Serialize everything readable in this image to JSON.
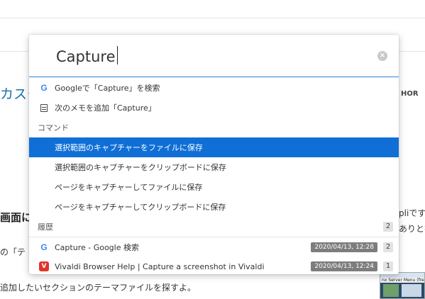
{
  "background": {
    "heading_fragment": "カスク",
    "author_label": "HOR",
    "section_heading": "画面に",
    "right_text_1": "pliです",
    "right_text_2": "ありと書",
    "left_text_1": "の「テ",
    "left_text_2": "追加したいセクションのテーマファイルを探すよ。",
    "thumb_title": "nx Server Menu (free E"
  },
  "quick_commands": {
    "search_value": "Capture",
    "clear_label": "×",
    "items": [
      {
        "icon": "google-icon",
        "icon_glyph": "G",
        "label": "Googleで「Capture」を検索"
      },
      {
        "icon": "note-icon",
        "label": "次のメモを追加「Capture」"
      }
    ],
    "commands_header": "コマンド",
    "commands": [
      {
        "label": "選択範囲のキャプチャーをファイルに保存",
        "selected": true
      },
      {
        "label": "選択範囲のキャプチャーをクリップボードに保存"
      },
      {
        "label": "ページをキャプチャーしてファイルに保存"
      },
      {
        "label": "ページをキャプチャーしてクリップボードに保存"
      }
    ],
    "history_header": "履歴",
    "history_count": "2",
    "history": [
      {
        "icon": "google-icon",
        "icon_glyph": "G",
        "label": "Capture - Google 検索",
        "date": "2020/04/13, 12:28",
        "count": "2"
      },
      {
        "icon": "vivaldi-icon",
        "icon_glyph": "V",
        "label": "Vivaldi Browser Help | Capture a screenshot in Vivaldi",
        "date": "2020/04/13, 12:24",
        "count": "1"
      }
    ]
  },
  "colors": {
    "selection": "#0f6fd6",
    "accent_line": "#2f7fd0",
    "vivaldi_red": "#e0352b",
    "google_blue": "#4285f4"
  }
}
